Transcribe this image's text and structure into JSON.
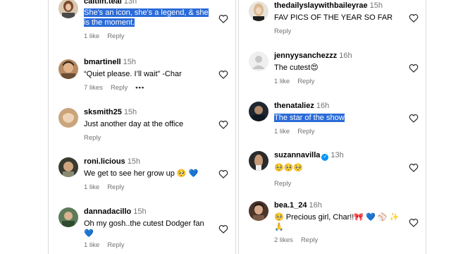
{
  "left": [
    {
      "user": "caitlin.teal",
      "time": "13h",
      "text": "She's an icon, she's a legend, & she is the moment.",
      "highlighted": true,
      "likes": "1 like",
      "reply": "Reply"
    },
    {
      "user": "bmartinell",
      "time": "15h",
      "text": "“Quiet please. I’ll wait” -Char",
      "likes": "7 likes",
      "reply": "Reply",
      "more": "•••"
    },
    {
      "user": "sksmith25",
      "time": "15h",
      "text": "Just another day at the office",
      "likes": "",
      "reply": "Reply"
    },
    {
      "user": "roni.licious",
      "time": "15h",
      "text": "We get to see her grow up 🥺 💙",
      "likes": "1 like",
      "reply": "Reply"
    },
    {
      "user": "dannadacillo",
      "time": "15h",
      "text": "Oh my gosh..the cutest Dodger fan 💙",
      "likes": "1 like",
      "reply": "Reply"
    }
  ],
  "right": [
    {
      "user": "thedailyslaywithbaileyrae",
      "time": "15h",
      "text": "FAV PICS OF THE YEAR SO FAR",
      "likes": "",
      "reply": "Reply"
    },
    {
      "user": "jennyysanchezzz",
      "time": "16h",
      "text": "The cutest😍",
      "likes": "1 like",
      "reply": "Reply"
    },
    {
      "user": "thenataliez",
      "time": "16h",
      "text": "The star of the show",
      "highlighted": true,
      "likes": "1 like",
      "reply": "Reply"
    },
    {
      "user": "suzannavilla",
      "time": "13h",
      "verified": true,
      "text": "🥺🥺🥺",
      "likes": "",
      "reply": "Reply"
    },
    {
      "user": "bea.1_24",
      "time": "16h",
      "text": "🥺 Precious girl, Char!!🎀 💙 ⚾ ✨ 🙏",
      "likes": "2 likes",
      "reply": "Reply"
    }
  ],
  "colors": {
    "highlight": "#2a6bd8",
    "meta": "#737373",
    "verified": "#0095f6"
  },
  "icons": {
    "like": "heart-outline-icon",
    "verified": "verified-badge-icon",
    "more": "more-options-icon"
  }
}
